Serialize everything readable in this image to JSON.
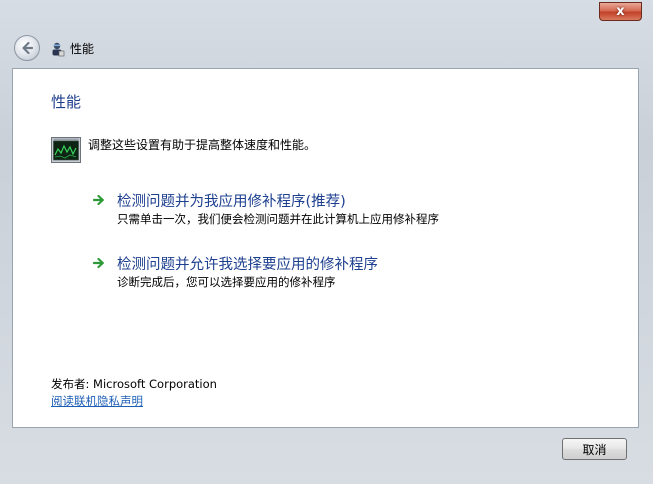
{
  "window": {
    "title": "性能",
    "close_label": "x"
  },
  "content": {
    "heading": "性能",
    "description": "调整这些设置有助于提高整体速度和性能。",
    "options": [
      {
        "title": "检测问题并为我应用修补程序(推荐)",
        "subtitle": "只需单击一次，我们便会检测问题并在此计算机上应用修补程序"
      },
      {
        "title": "检测问题并允许我选择要应用的修补程序",
        "subtitle": "诊断完成后，您可以选择要应用的修补程序"
      }
    ],
    "publisher": "发布者: Microsoft Corporation",
    "privacy_link": "阅读联机隐私声明"
  },
  "footer": {
    "cancel_label": "取消"
  },
  "icons": {
    "back": "back-arrow-icon",
    "app": "performance-troubleshooter-icon",
    "monitor": "performance-monitor-icon",
    "option_arrow": "green-arrow-icon"
  },
  "colors": {
    "heading": "#1e3e8c",
    "link": "#1e5fb6",
    "option_title": "#1d3f8f",
    "arrow_green": "#2e9a3a",
    "close_red": "#c2412a"
  }
}
